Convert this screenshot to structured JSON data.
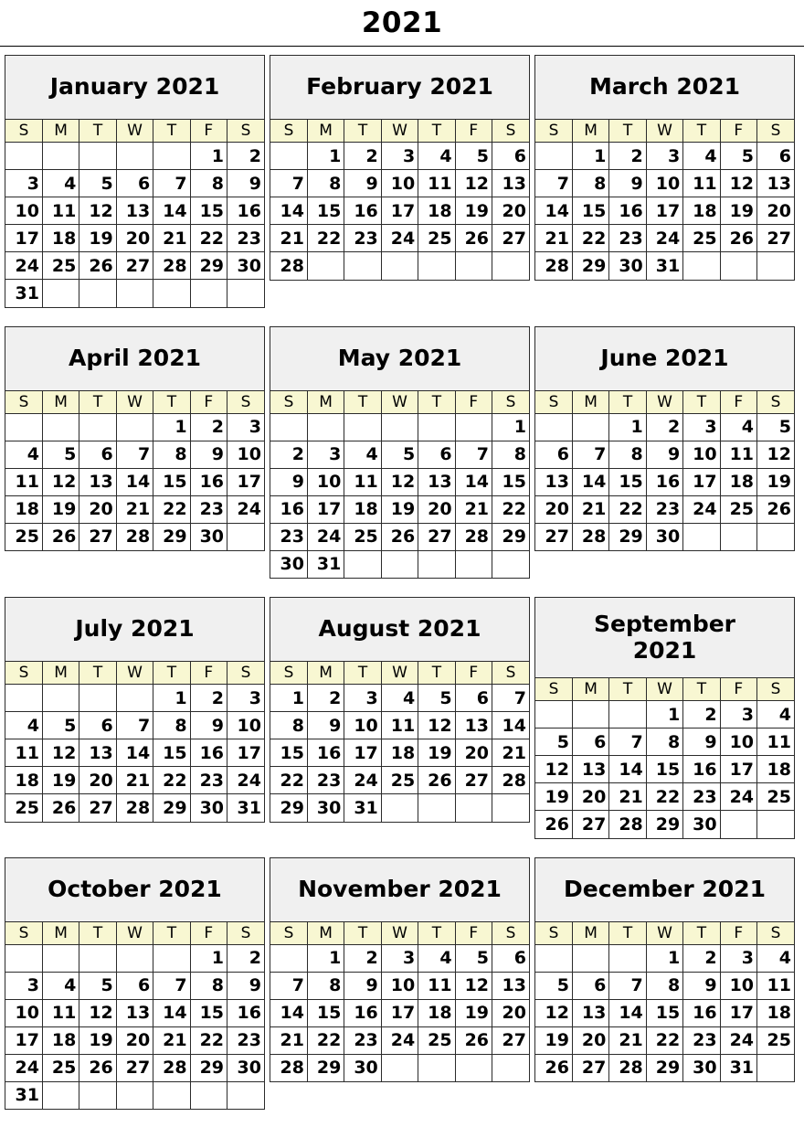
{
  "page": {
    "year_title": "2021"
  },
  "weekday_headers": [
    "S",
    "M",
    "T",
    "W",
    "T",
    "F",
    "S"
  ],
  "colors": {
    "header_background": "#f0f0f0",
    "weekday_background": "#f8f7d2",
    "border": "#2b2b2b",
    "text": "#000000",
    "page_background": "#ffffff"
  },
  "quarters": [
    {
      "months": [
        {
          "title": "January 2021",
          "name": "January",
          "year": "2021",
          "title_lines": [
            "January 2021"
          ],
          "days_in_month": 31,
          "start_weekday_index": 5,
          "weeks": [
            [
              "",
              "",
              "",
              "",
              "",
              "1",
              "2"
            ],
            [
              "3",
              "4",
              "5",
              "6",
              "7",
              "8",
              "9"
            ],
            [
              "10",
              "11",
              "12",
              "13",
              "14",
              "15",
              "16"
            ],
            [
              "17",
              "18",
              "19",
              "20",
              "21",
              "22",
              "23"
            ],
            [
              "24",
              "25",
              "26",
              "27",
              "28",
              "29",
              "30"
            ],
            [
              "31",
              "",
              "",
              "",
              "",
              "",
              ""
            ]
          ]
        },
        {
          "title": "February 2021",
          "name": "February",
          "year": "2021",
          "title_lines": [
            "February 2021"
          ],
          "days_in_month": 28,
          "start_weekday_index": 1,
          "weeks": [
            [
              "",
              "1",
              "2",
              "3",
              "4",
              "5",
              "6"
            ],
            [
              "7",
              "8",
              "9",
              "10",
              "11",
              "12",
              "13"
            ],
            [
              "14",
              "15",
              "16",
              "17",
              "18",
              "19",
              "20"
            ],
            [
              "21",
              "22",
              "23",
              "24",
              "25",
              "26",
              "27"
            ],
            [
              "28",
              "",
              "",
              "",
              "",
              "",
              ""
            ]
          ]
        },
        {
          "title": "March 2021",
          "name": "March",
          "year": "2021",
          "title_lines": [
            "March 2021"
          ],
          "days_in_month": 31,
          "start_weekday_index": 1,
          "weeks": [
            [
              "",
              "1",
              "2",
              "3",
              "4",
              "5",
              "6"
            ],
            [
              "7",
              "8",
              "9",
              "10",
              "11",
              "12",
              "13"
            ],
            [
              "14",
              "15",
              "16",
              "17",
              "18",
              "19",
              "20"
            ],
            [
              "21",
              "22",
              "23",
              "24",
              "25",
              "26",
              "27"
            ],
            [
              "28",
              "29",
              "30",
              "31",
              "",
              "",
              ""
            ]
          ]
        }
      ]
    },
    {
      "months": [
        {
          "title": "April 2021",
          "name": "April",
          "year": "2021",
          "title_lines": [
            "April 2021"
          ],
          "days_in_month": 30,
          "start_weekday_index": 4,
          "weeks": [
            [
              "",
              "",
              "",
              "",
              "1",
              "2",
              "3"
            ],
            [
              "4",
              "5",
              "6",
              "7",
              "8",
              "9",
              "10"
            ],
            [
              "11",
              "12",
              "13",
              "14",
              "15",
              "16",
              "17"
            ],
            [
              "18",
              "19",
              "20",
              "21",
              "22",
              "23",
              "24"
            ],
            [
              "25",
              "26",
              "27",
              "28",
              "29",
              "30",
              ""
            ]
          ]
        },
        {
          "title": "May 2021",
          "name": "May",
          "year": "2021",
          "title_lines": [
            "May 2021"
          ],
          "days_in_month": 31,
          "start_weekday_index": 6,
          "weeks": [
            [
              "",
              "",
              "",
              "",
              "",
              "",
              "1"
            ],
            [
              "2",
              "3",
              "4",
              "5",
              "6",
              "7",
              "8"
            ],
            [
              "9",
              "10",
              "11",
              "12",
              "13",
              "14",
              "15"
            ],
            [
              "16",
              "17",
              "18",
              "19",
              "20",
              "21",
              "22"
            ],
            [
              "23",
              "24",
              "25",
              "26",
              "27",
              "28",
              "29"
            ],
            [
              "30",
              "31",
              "",
              "",
              "",
              "",
              ""
            ]
          ]
        },
        {
          "title": "June 2021",
          "name": "June",
          "year": "2021",
          "title_lines": [
            "June 2021"
          ],
          "days_in_month": 30,
          "start_weekday_index": 2,
          "weeks": [
            [
              "",
              "",
              "1",
              "2",
              "3",
              "4",
              "5"
            ],
            [
              "6",
              "7",
              "8",
              "9",
              "10",
              "11",
              "12"
            ],
            [
              "13",
              "14",
              "15",
              "16",
              "17",
              "18",
              "19"
            ],
            [
              "20",
              "21",
              "22",
              "23",
              "24",
              "25",
              "26"
            ],
            [
              "27",
              "28",
              "29",
              "30",
              "",
              "",
              ""
            ]
          ]
        }
      ]
    },
    {
      "months": [
        {
          "title": "July 2021",
          "name": "July",
          "year": "2021",
          "title_lines": [
            "July 2021"
          ],
          "days_in_month": 31,
          "start_weekday_index": 4,
          "weeks": [
            [
              "",
              "",
              "",
              "",
              "1",
              "2",
              "3"
            ],
            [
              "4",
              "5",
              "6",
              "7",
              "8",
              "9",
              "10"
            ],
            [
              "11",
              "12",
              "13",
              "14",
              "15",
              "16",
              "17"
            ],
            [
              "18",
              "19",
              "20",
              "21",
              "22",
              "23",
              "24"
            ],
            [
              "25",
              "26",
              "27",
              "28",
              "29",
              "30",
              "31"
            ]
          ]
        },
        {
          "title": "August 2021",
          "name": "August",
          "year": "2021",
          "title_lines": [
            "August 2021"
          ],
          "days_in_month": 31,
          "start_weekday_index": 0,
          "weeks": [
            [
              "1",
              "2",
              "3",
              "4",
              "5",
              "6",
              "7"
            ],
            [
              "8",
              "9",
              "10",
              "11",
              "12",
              "13",
              "14"
            ],
            [
              "15",
              "16",
              "17",
              "18",
              "19",
              "20",
              "21"
            ],
            [
              "22",
              "23",
              "24",
              "25",
              "26",
              "27",
              "28"
            ],
            [
              "29",
              "30",
              "31",
              "",
              "",
              "",
              ""
            ]
          ]
        },
        {
          "title": "September 2021",
          "name": "September",
          "year": "2021",
          "title_lines": [
            "September",
            "2021"
          ],
          "days_in_month": 30,
          "start_weekday_index": 3,
          "weeks": [
            [
              "",
              "",
              "",
              "1",
              "2",
              "3",
              "4"
            ],
            [
              "5",
              "6",
              "7",
              "8",
              "9",
              "10",
              "11"
            ],
            [
              "12",
              "13",
              "14",
              "15",
              "16",
              "17",
              "18"
            ],
            [
              "19",
              "20",
              "21",
              "22",
              "23",
              "24",
              "25"
            ],
            [
              "26",
              "27",
              "28",
              "29",
              "30",
              "",
              ""
            ]
          ]
        }
      ]
    },
    {
      "months": [
        {
          "title": "October 2021",
          "name": "October",
          "year": "2021",
          "title_lines": [
            "October 2021"
          ],
          "days_in_month": 31,
          "start_weekday_index": 5,
          "weeks": [
            [
              "",
              "",
              "",
              "",
              "",
              "1",
              "2"
            ],
            [
              "3",
              "4",
              "5",
              "6",
              "7",
              "8",
              "9"
            ],
            [
              "10",
              "11",
              "12",
              "13",
              "14",
              "15",
              "16"
            ],
            [
              "17",
              "18",
              "19",
              "20",
              "21",
              "22",
              "23"
            ],
            [
              "24",
              "25",
              "26",
              "27",
              "28",
              "29",
              "30"
            ],
            [
              "31",
              "",
              "",
              "",
              "",
              "",
              ""
            ]
          ]
        },
        {
          "title": "November 2021",
          "name": "November",
          "year": "2021",
          "title_lines": [
            "November 2021"
          ],
          "days_in_month": 30,
          "start_weekday_index": 1,
          "weeks": [
            [
              "",
              "1",
              "2",
              "3",
              "4",
              "5",
              "6"
            ],
            [
              "7",
              "8",
              "9",
              "10",
              "11",
              "12",
              "13"
            ],
            [
              "14",
              "15",
              "16",
              "17",
              "18",
              "19",
              "20"
            ],
            [
              "21",
              "22",
              "23",
              "24",
              "25",
              "26",
              "27"
            ],
            [
              "28",
              "29",
              "30",
              "",
              "",
              "",
              ""
            ]
          ]
        },
        {
          "title": "December 2021",
          "name": "December",
          "year": "2021",
          "title_lines": [
            "December 2021"
          ],
          "days_in_month": 31,
          "start_weekday_index": 3,
          "weeks": [
            [
              "",
              "",
              "",
              "1",
              "2",
              "3",
              "4"
            ],
            [
              "5",
              "6",
              "7",
              "8",
              "9",
              "10",
              "11"
            ],
            [
              "12",
              "13",
              "14",
              "15",
              "16",
              "17",
              "18"
            ],
            [
              "19",
              "20",
              "21",
              "22",
              "23",
              "24",
              "25"
            ],
            [
              "26",
              "27",
              "28",
              "29",
              "30",
              "31",
              ""
            ]
          ]
        }
      ]
    }
  ]
}
